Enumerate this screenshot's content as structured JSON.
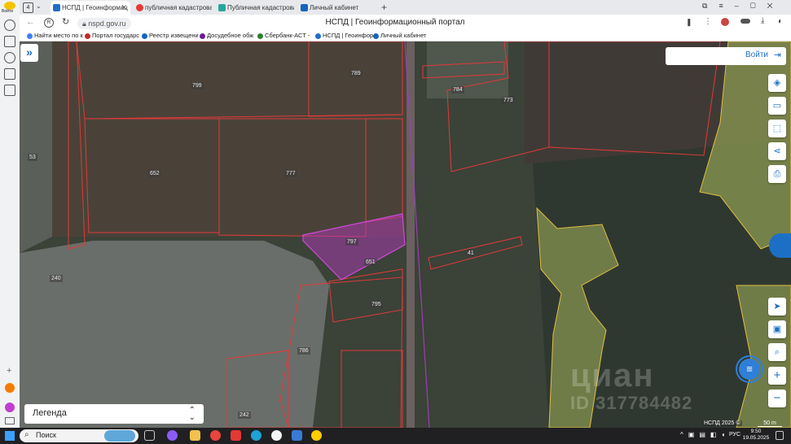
{
  "browser": {
    "tab_count": "4",
    "tabs": [
      {
        "label": "НСПД | Геоинформац",
        "color": "#1d6fc6",
        "active": true
      },
      {
        "label": "публичная кадастровая к",
        "color": "#e53935",
        "active": false
      },
      {
        "label": "Публичная кадастровая к",
        "color": "#26a69a",
        "active": false
      },
      {
        "label": "Личный кабинет",
        "color": "#1565c0",
        "active": false
      }
    ],
    "url": "nspd.gov.ru",
    "page_title": "НСПД | Геоинформационный портал",
    "bookmarks": [
      {
        "label": "Найти место по к",
        "color": "#3b82f6"
      },
      {
        "label": "Портал государс",
        "color": "#c62828"
      },
      {
        "label": "Реестр извещени",
        "color": "#1565c0"
      },
      {
        "label": "Досудебное обж",
        "color": "#6a1b9a"
      },
      {
        "label": "Сбербанк-АСТ -",
        "color": "#2e7d32"
      },
      {
        "label": "НСПД | Геоинфор",
        "color": "#1d6fc6"
      },
      {
        "label": "Личный кабинет",
        "color": "#1565c0"
      }
    ],
    "rail_label": "Войти"
  },
  "map": {
    "login_label": "Войти",
    "expand_icon": "»",
    "parcels": [
      {
        "id": "p-799",
        "label": "799"
      },
      {
        "id": "p-789",
        "label": "789"
      },
      {
        "id": "p-784",
        "label": "784"
      },
      {
        "id": "p-773",
        "label": "773"
      },
      {
        "id": "p-53",
        "label": "53"
      },
      {
        "id": "p-652",
        "label": "652"
      },
      {
        "id": "p-777",
        "label": "777"
      },
      {
        "id": "p-797",
        "label": "797"
      },
      {
        "id": "p-651",
        "label": "651"
      },
      {
        "id": "p-41",
        "label": "41"
      },
      {
        "id": "p-240",
        "label": "240"
      },
      {
        "id": "p-795",
        "label": "795"
      },
      {
        "id": "p-786",
        "label": "786"
      },
      {
        "id": "p-242",
        "label": "242"
      }
    ],
    "legend_label": "Легенда",
    "watermark": "циан",
    "watermark_id": "ID 317784482",
    "credit": "НСПД 2025 ©",
    "scale_label": "50 m",
    "highlight_color": "#b03ab8",
    "boundary_color": "#e03a3a"
  },
  "taskbar": {
    "search_label": "Поиск",
    "lang": "РУС",
    "time": "9:50",
    "date": "19.05.2025"
  }
}
